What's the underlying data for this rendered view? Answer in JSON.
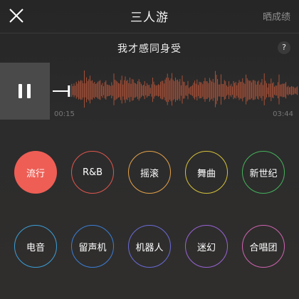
{
  "header": {
    "title": "三人游",
    "share_label": "晒成绩"
  },
  "song": {
    "title": "我才感同身受",
    "help_label": "?"
  },
  "player": {
    "state": "playing",
    "time_current": "00:15",
    "time_total": "03:44",
    "progress": 0.067
  },
  "colors": {
    "accent": "#ee5e55",
    "wave": "#b5553a"
  },
  "genres": [
    {
      "label": "流行",
      "color": "#ee5e55",
      "active": true
    },
    {
      "label": "R&B",
      "color": "#e0564e",
      "active": false
    },
    {
      "label": "摇滚",
      "color": "#e5a24a",
      "active": false
    },
    {
      "label": "舞曲",
      "color": "#d6c23b",
      "active": false
    },
    {
      "label": "新世纪",
      "color": "#46b35c",
      "active": false
    },
    {
      "label": "电音",
      "color": "#3b9fd6",
      "active": false
    },
    {
      "label": "留声机",
      "color": "#3b7fd6",
      "active": false
    },
    {
      "label": "机器人",
      "color": "#6a6bd6",
      "active": false
    },
    {
      "label": "迷幻",
      "color": "#9a64d6",
      "active": false
    },
    {
      "label": "合唱团",
      "color": "#d064b0",
      "active": false
    }
  ]
}
